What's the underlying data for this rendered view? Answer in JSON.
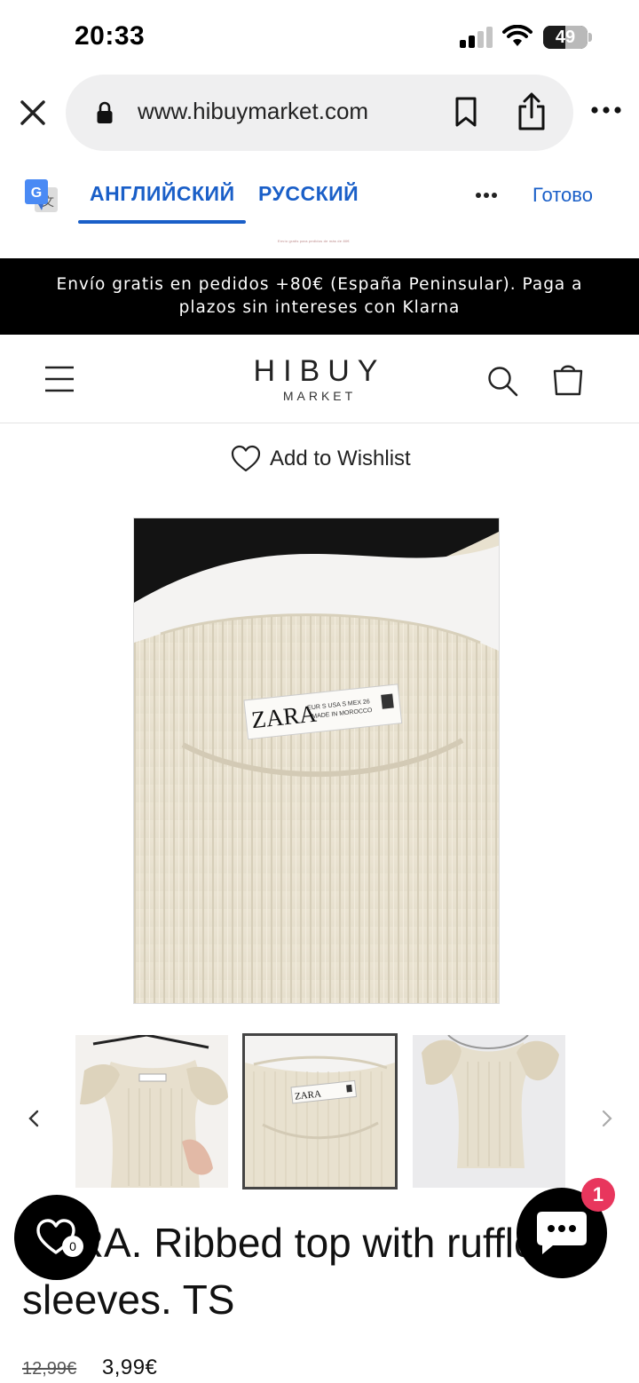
{
  "status_bar": {
    "time": "20:33",
    "battery_percent": "49",
    "battery_level": 0.49,
    "signal_bars_on": 2,
    "signal_bars_total": 4
  },
  "browser": {
    "url": "www.hibuymarket.com"
  },
  "translate": {
    "lang_source": "АНГЛИЙСКИЙ",
    "lang_target": "РУССКИЙ",
    "done_label": "Готово",
    "active_color": "#1a5fc8"
  },
  "announcement": {
    "line1": "Envío gratis en pedidos +80€ (España Peninsular). Paga a",
    "line2": "plazos sin intereses con Klarna",
    "tiny_line": "Envío gratis para pedidos de más de 80€"
  },
  "store": {
    "logo_main": "HIBUY",
    "logo_sub": "MARKET"
  },
  "product": {
    "wishlist_label": "Add to Wishlist",
    "title_line1": "ZARA. Ribbed top with ruffle",
    "title_line2": "sleeves. TS",
    "price_old": "12,99€",
    "price_new": "3,99€",
    "label_brand": "ZARA",
    "label_sizes": "EUR S USA S MEX 26",
    "label_origin": "MADE IN MOROCCO",
    "thumbnails": [
      "front-with-ruffles",
      "label-closeup",
      "full-top"
    ],
    "selected_thumbnail": 1
  },
  "floating": {
    "wishlist_count": "0",
    "chat_badge": "1",
    "badge_color": "#e8365d"
  },
  "icons": {
    "close": "close-icon",
    "lock": "lock-icon",
    "bookmark": "bookmark-icon",
    "share": "share-icon",
    "more": "more-icon",
    "translate": "google-translate-icon",
    "menu": "hamburger-menu-icon",
    "search": "search-icon",
    "cart": "cart-icon",
    "heart": "heart-icon",
    "chat": "chat-icon",
    "prev": "chevron-left-icon",
    "next": "chevron-right-icon"
  }
}
